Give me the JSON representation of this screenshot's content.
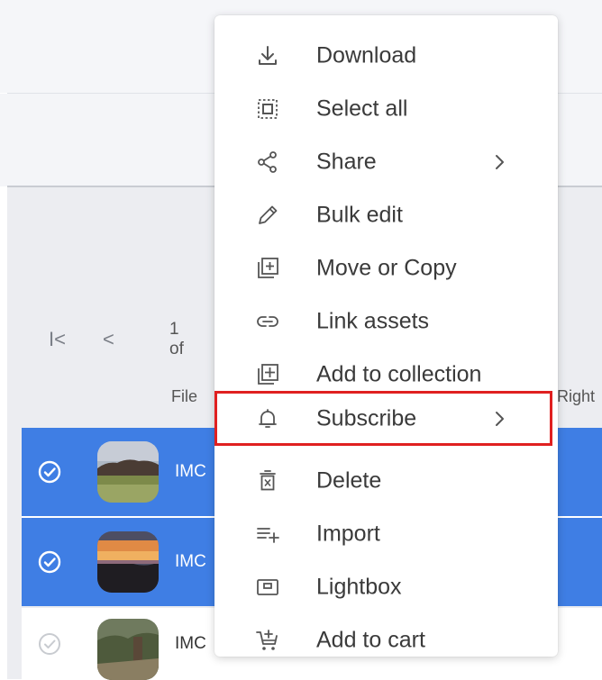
{
  "pagination": {
    "first_glyph": "I<",
    "prev_glyph": "<",
    "count_text": "1 of"
  },
  "table": {
    "col_file": "File",
    "col_right": "Right",
    "rows": [
      {
        "name": "IMC",
        "selected": true,
        "check_icon": "check-circle-icon"
      },
      {
        "name": "IMC",
        "selected": true,
        "check_icon": "check-circle-icon"
      },
      {
        "name": "IMC",
        "selected": false,
        "check_icon": "check-circle-outline-icon"
      }
    ]
  },
  "menu": {
    "items": [
      {
        "label": "Download",
        "icon": "download-icon"
      },
      {
        "label": "Select all",
        "icon": "select-all-icon"
      },
      {
        "label": "Share",
        "icon": "share-icon",
        "submenu": true
      },
      {
        "label": "Bulk edit",
        "icon": "pencil-icon"
      },
      {
        "label": "Move or Copy",
        "icon": "move-copy-icon"
      },
      {
        "label": "Link assets",
        "icon": "link-icon"
      },
      {
        "label": "Add to collection",
        "icon": "add-collection-icon"
      },
      {
        "label": "Subscribe",
        "icon": "bell-icon",
        "submenu": true,
        "highlighted": true
      },
      {
        "label": "Delete",
        "icon": "trash-icon"
      },
      {
        "label": "Import",
        "icon": "import-icon"
      },
      {
        "label": "Lightbox",
        "icon": "lightbox-icon"
      },
      {
        "label": "Add to cart",
        "icon": "cart-icon"
      }
    ]
  },
  "colors": {
    "selected_row": "#3f7ee4",
    "highlight_outline": "#e02020",
    "menu_text": "#3a3a3a"
  }
}
